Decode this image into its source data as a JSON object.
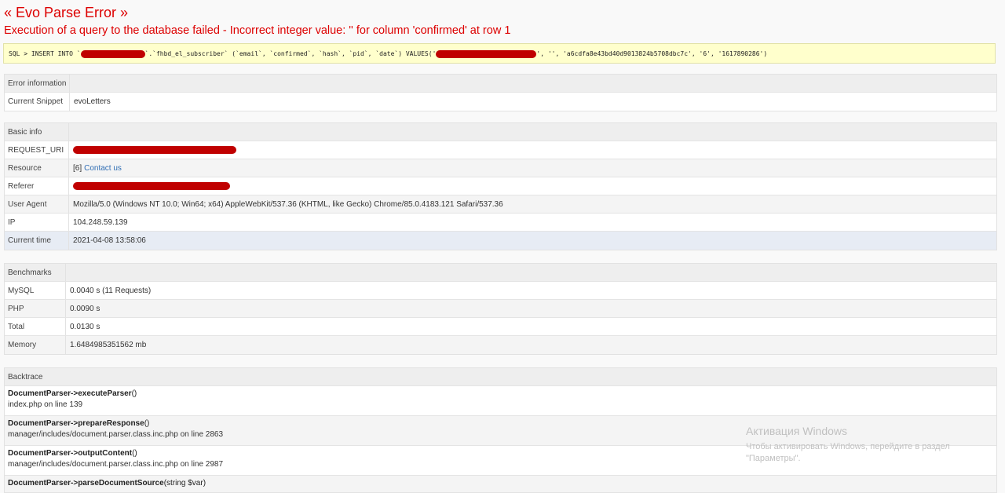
{
  "page": {
    "title": "« Evo Parse Error »",
    "subtitle": "Execution of a query to the database failed - Incorrect integer value: '' for column 'confirmed' at row 1"
  },
  "sql": {
    "part1": "SQL > INSERT INTO `",
    "part2": "`.`fhbd_el_subscriber` (`email`, `confirmed`, `hash`, `pid`, `date`) VALUES('",
    "part3": "', '', 'a6cdfa8e43bd40d9013824b5708dbc7c', '6', '1617890286')"
  },
  "error_info": {
    "header": "Error information",
    "rows": [
      {
        "key": "Current Snippet",
        "value": "evoLetters"
      }
    ]
  },
  "basic_info": {
    "header": "Basic info",
    "request_uri_label": "REQUEST_URI",
    "resource_label": "Resource",
    "resource_prefix": "[6]",
    "resource_link": "Contact us",
    "referer_label": "Referer",
    "user_agent_label": "User Agent",
    "user_agent": "Mozilla/5.0 (Windows NT 10.0; Win64; x64) AppleWebKit/537.36 (KHTML, like Gecko) Chrome/85.0.4183.121 Safari/537.36",
    "ip_label": "IP",
    "ip": "104.248.59.139",
    "time_label": "Current time",
    "time": "2021-04-08 13:58:06"
  },
  "benchmarks": {
    "header": "Benchmarks",
    "rows": [
      {
        "key": "MySQL",
        "value": "0.0040 s (11 Requests)"
      },
      {
        "key": "PHP",
        "value": "0.0090 s"
      },
      {
        "key": "Total",
        "value": "0.0130 s"
      },
      {
        "key": "Memory",
        "value": "1.6484985351562 mb"
      }
    ]
  },
  "backtrace": {
    "header": "Backtrace",
    "items": [
      {
        "cls": "DocumentParser->",
        "method": "executeParser",
        "args": "()",
        "loc": "index.php on line 139"
      },
      {
        "cls": "DocumentParser->",
        "method": "prepareResponse",
        "args": "()",
        "loc": "manager/includes/document.parser.class.inc.php on line 2863"
      },
      {
        "cls": "DocumentParser->",
        "method": "outputContent",
        "args": "()",
        "loc": "manager/includes/document.parser.class.inc.php on line 2987"
      },
      {
        "cls": "DocumentParser->",
        "method": "parseDocumentSource",
        "args": "(string $var)",
        "loc": ""
      }
    ]
  },
  "watermark": {
    "line1": "Активация Windows",
    "line2": "Чтобы активировать Windows, перейдите в раздел \"Параметры\"."
  },
  "colors": {
    "error_red": "#dd0000",
    "redaction": "#c00000",
    "link": "#2f6db3",
    "sql_bg": "#ffffcc"
  }
}
